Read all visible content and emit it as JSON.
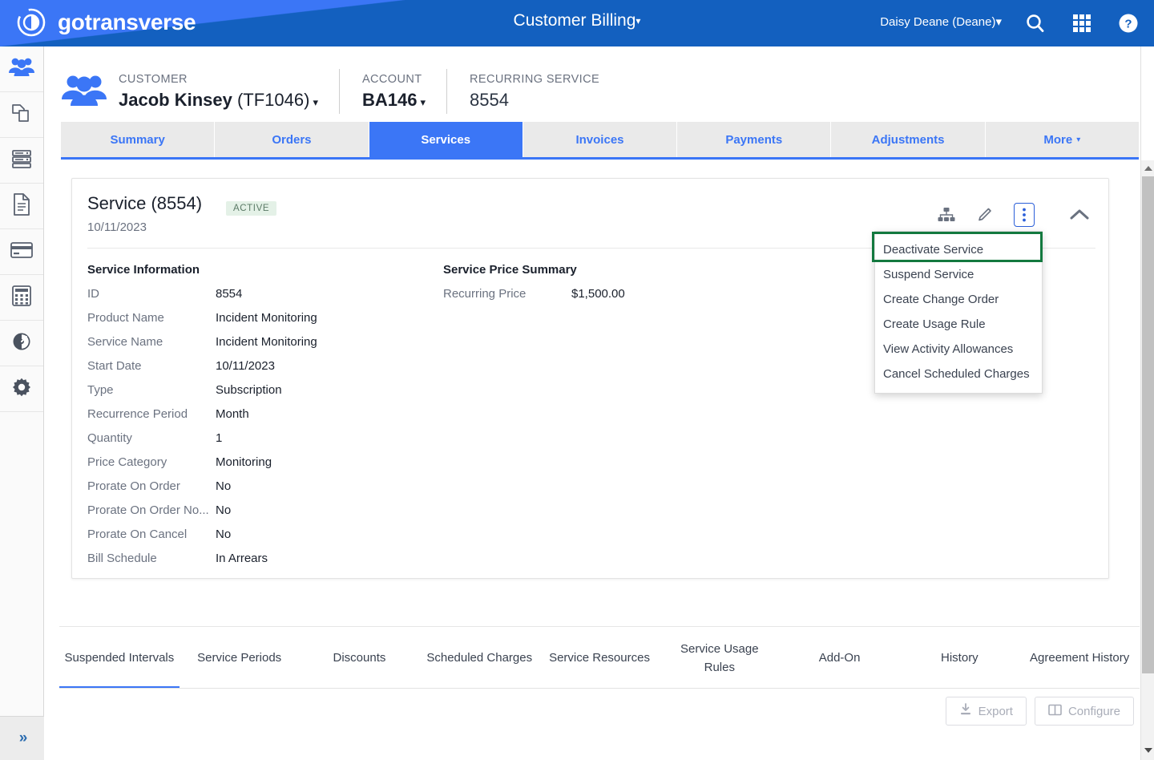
{
  "header": {
    "logo_text": "gotransverse",
    "app_title": "Customer Billing",
    "app_title_caret": "▾",
    "user": "Daisy Deane (Deane)",
    "user_caret": "▾",
    "icons": [
      "search-icon",
      "apps-grid-icon",
      "help-icon"
    ],
    "colors": {
      "light_blue": "#3B76F6",
      "dark_blue": "#1360BF"
    }
  },
  "sidebar": {
    "items": [
      {
        "name": "customers",
        "icon": "people-icon",
        "active": true
      },
      {
        "name": "products",
        "icon": "copy-documents-icon",
        "active": false
      },
      {
        "name": "servers",
        "icon": "database-icon",
        "active": false
      },
      {
        "name": "documents",
        "icon": "document-icon",
        "active": false
      },
      {
        "name": "payments",
        "icon": "credit-card-icon",
        "active": false
      },
      {
        "name": "calculations",
        "icon": "calculator-icon",
        "active": false
      },
      {
        "name": "reports",
        "icon": "gauge-icon",
        "active": false
      },
      {
        "name": "settings",
        "icon": "gear-icon",
        "active": false
      }
    ],
    "expand_glyph": "»"
  },
  "breadcrumb": {
    "customer_label": "CUSTOMER",
    "customer_name": "Jacob Kinsey",
    "customer_id": "(TF1046)",
    "account_label": "ACCOUNT",
    "account_value": "BA146",
    "service_label": "RECURRING SERVICE",
    "service_value": "8554",
    "caret": "▾"
  },
  "tabs": [
    {
      "label": "Summary",
      "active": false
    },
    {
      "label": "Orders",
      "active": false
    },
    {
      "label": "Services",
      "active": true
    },
    {
      "label": "Invoices",
      "active": false
    },
    {
      "label": "Payments",
      "active": false
    },
    {
      "label": "Adjustments",
      "active": false
    },
    {
      "label": "More",
      "active": false,
      "caret": "▾"
    }
  ],
  "card": {
    "title": "Service (8554)",
    "status_badge": "ACTIVE",
    "date": "10/11/2023",
    "actions": [
      "hierarchy-icon",
      "edit-pencil-icon",
      "more-vertical-icon",
      "collapse-chevron-icon"
    ],
    "info_heading": "Service Information",
    "info_rows": [
      {
        "key": "ID",
        "value": "8554"
      },
      {
        "key": "Product Name",
        "value": "Incident Monitoring"
      },
      {
        "key": "Service Name",
        "value": "Incident Monitoring"
      },
      {
        "key": "Start Date",
        "value": "10/11/2023"
      },
      {
        "key": "Type",
        "value": "Subscription"
      },
      {
        "key": "Recurrence Period",
        "value": "Month"
      },
      {
        "key": "Quantity",
        "value": "1"
      },
      {
        "key": "Price Category",
        "value": "Monitoring"
      },
      {
        "key": "Prorate On Order",
        "value": "No"
      },
      {
        "key": "Prorate On Order No...",
        "value": "No"
      },
      {
        "key": "Prorate On Cancel",
        "value": "No"
      },
      {
        "key": "Bill Schedule",
        "value": "In Arrears"
      }
    ],
    "price_heading": "Service Price Summary",
    "price_rows": [
      {
        "key": "Recurring Price",
        "value": "$1,500.00"
      }
    ]
  },
  "menu": {
    "items": [
      {
        "label": "Deactivate Service",
        "highlighted": true
      },
      {
        "label": "Suspend Service",
        "highlighted": false
      },
      {
        "label": "Create Change Order",
        "highlighted": false
      },
      {
        "label": "Create Usage Rule",
        "highlighted": false
      },
      {
        "label": "View Activity Allowances",
        "highlighted": false
      },
      {
        "label": "Cancel Scheduled Charges",
        "highlighted": false
      }
    ],
    "highlight_color": "#13793f"
  },
  "bottom_tabs": [
    {
      "label": "Suspended Intervals",
      "active": true
    },
    {
      "label": "Service Periods",
      "active": false
    },
    {
      "label": "Discounts",
      "active": false
    },
    {
      "label": "Scheduled Charges",
      "active": false
    },
    {
      "label": "Service Resources",
      "active": false
    },
    {
      "label": "Service Usage Rules",
      "active": false
    },
    {
      "label": "Add-On",
      "active": false
    },
    {
      "label": "History",
      "active": false
    },
    {
      "label": "Agreement History",
      "active": false
    }
  ],
  "bottom_buttons": {
    "export_label": "Export",
    "configure_label": "Configure"
  }
}
